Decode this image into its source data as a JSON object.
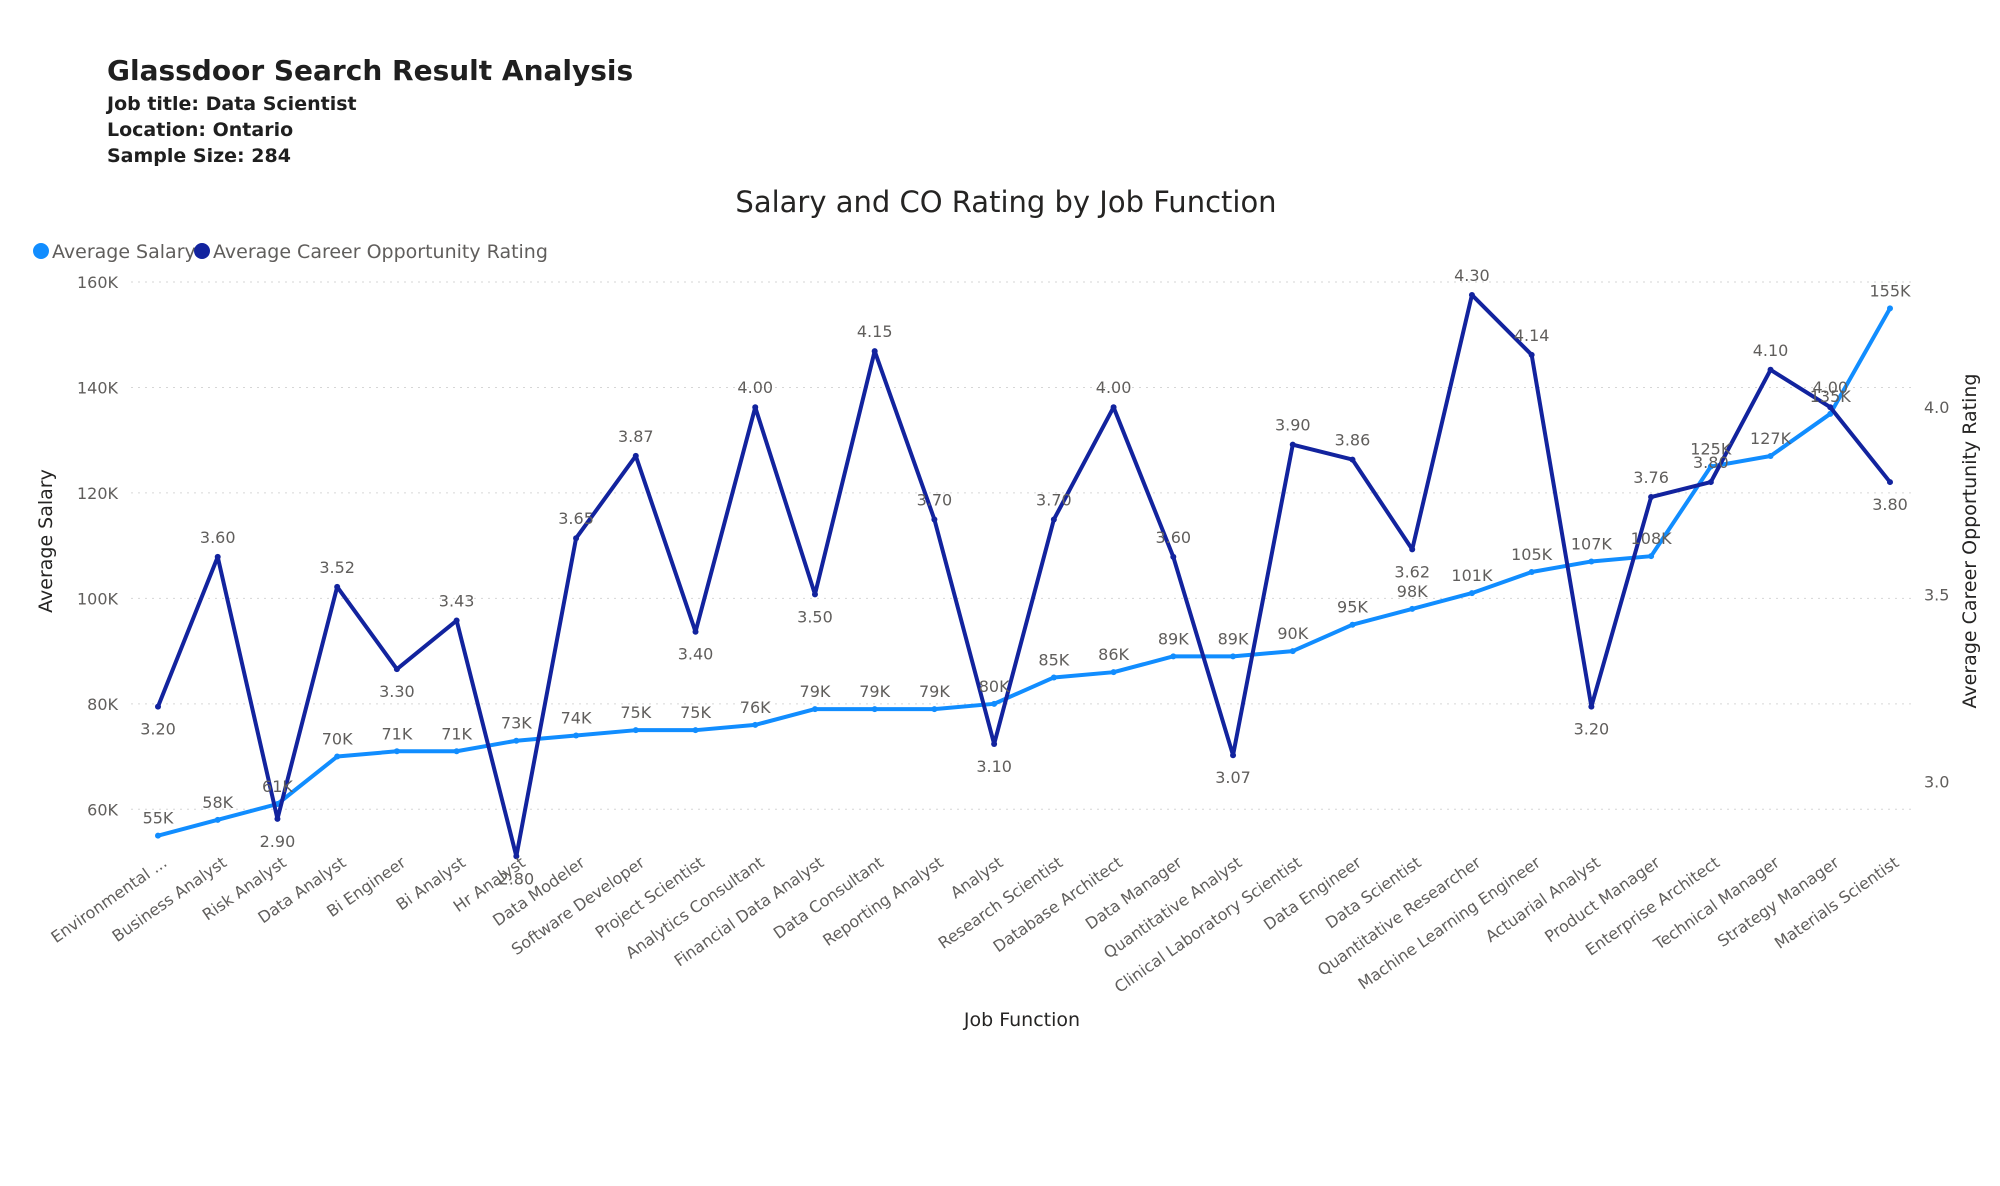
{
  "header": {
    "title": "Glassdoor Search Result Analysis",
    "job_title": "Job title: Data Scientist",
    "location": "Location: Ontario",
    "sample_size": "Sample Size: 284"
  },
  "chart_data": {
    "type": "line",
    "title": "Salary and CO Rating by Job Function",
    "xlabel": "Job Function",
    "ylabel": "Average Salary",
    "y2label": "Average Career Opportunity Rating",
    "ylim": [
      50000,
      160000
    ],
    "y2lim": [
      2.79,
      4.34
    ],
    "yticks": [
      {
        "v": 60000,
        "label": "60K"
      },
      {
        "v": 80000,
        "label": "80K"
      },
      {
        "v": 100000,
        "label": "100K"
      },
      {
        "v": 120000,
        "label": "120K"
      },
      {
        "v": 140000,
        "label": "140K"
      },
      {
        "v": 160000,
        "label": "160K"
      }
    ],
    "y2ticks": [
      {
        "v": 3.0,
        "label": "3.0"
      },
      {
        "v": 3.5,
        "label": "3.5"
      },
      {
        "v": 4.0,
        "label": "4.0"
      }
    ],
    "grid": true,
    "legend_position": "top-left",
    "categories": [
      "Environmental ...",
      "Business Analyst",
      "Risk Analyst",
      "Data Analyst",
      "Bi Engineer",
      "Bi Analyst",
      "Hr Analyst",
      "Data Modeler",
      "Software Developer",
      "Project Scientist",
      "Analytics Consultant",
      "Financial Data Analyst",
      "Data Consultant",
      "Reporting Analyst",
      "Analyst",
      "Research Scientist",
      "Database Architect",
      "Data Manager",
      "Quantitative Analyst",
      "Clinical Laboratory Scientist",
      "Data Engineer",
      "Data Scientist",
      "Quantitative Researcher",
      "Machine Learning Engineer",
      "Actuarial Analyst",
      "Product Manager",
      "Enterprise Architect",
      "Technical Manager",
      "Strategy Manager",
      "Materials Scientist"
    ],
    "series": [
      {
        "name": "Average Salary",
        "axis": "left",
        "color": "#118dff",
        "values": [
          55000,
          58000,
          61000,
          70000,
          71000,
          71000,
          73000,
          74000,
          75000,
          75000,
          76000,
          79000,
          79000,
          79000,
          80000,
          85000,
          86000,
          89000,
          89000,
          90000,
          95000,
          98000,
          101000,
          105000,
          107000,
          108000,
          125000,
          127000,
          135000,
          155000
        ],
        "labels": [
          "55K",
          "58K",
          "61K",
          "70K",
          "71K",
          "71K",
          "73K",
          "74K",
          "75K",
          "75K",
          "76K",
          "79K",
          "79K",
          "79K",
          "80K",
          "85K",
          "86K",
          "89K",
          "89K",
          "90K",
          "95K",
          "98K",
          "101K",
          "105K",
          "107K",
          "108K",
          "125K",
          "127K",
          "135K",
          "155K"
        ]
      },
      {
        "name": "Average Career Opportunity Rating",
        "axis": "right",
        "color": "#12239e",
        "values": [
          3.2,
          3.6,
          2.9,
          3.52,
          3.3,
          3.43,
          2.8,
          3.65,
          3.87,
          3.4,
          4.0,
          3.5,
          4.15,
          3.7,
          3.1,
          3.7,
          4.0,
          3.6,
          3.07,
          3.9,
          3.86,
          3.62,
          4.3,
          4.14,
          3.2,
          3.76,
          3.8,
          4.1,
          4.0,
          3.8
        ],
        "labels": [
          "3.20",
          "3.60",
          "2.90",
          "3.52",
          "3.30",
          "3.43",
          "2.80",
          "3.65",
          "3.87",
          "3.40",
          "4.00",
          "3.50",
          "4.15",
          "3.70",
          "3.10",
          "3.70",
          "4.00",
          "3.60",
          "3.07",
          "3.90",
          "3.86",
          "3.62",
          "4.30",
          "4.14",
          "3.20",
          "3.76",
          "3.80",
          "4.10",
          "4.00",
          "3.80"
        ]
      }
    ]
  }
}
